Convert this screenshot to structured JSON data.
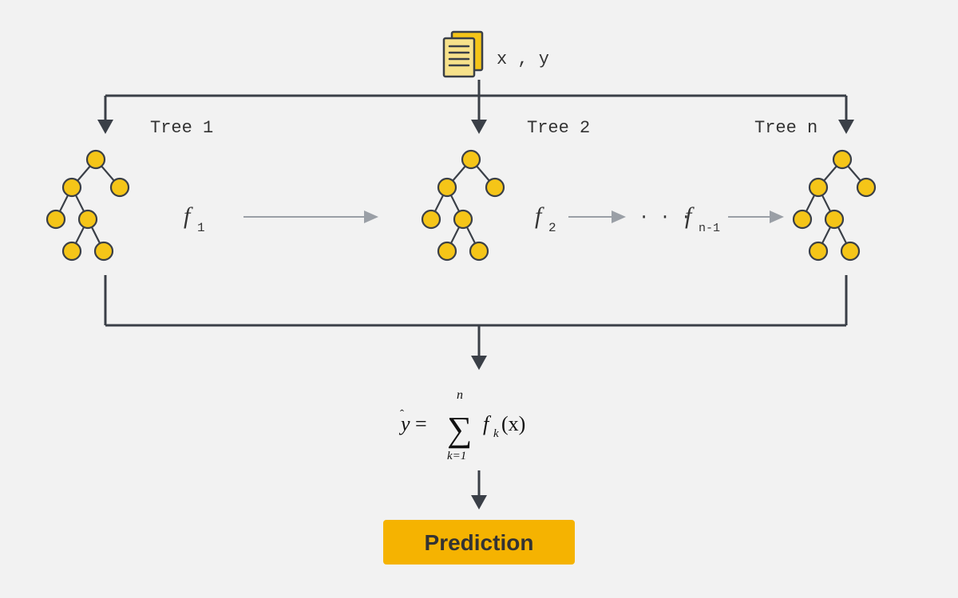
{
  "data_label": "x , y",
  "trees": [
    {
      "label": "Tree 1",
      "f_base": "f",
      "f_sub": "1"
    },
    {
      "label": "Tree 2",
      "f_base": "f",
      "f_sub": "2"
    },
    {
      "label": "Tree n",
      "f_base": "f",
      "f_sub": "n-1"
    }
  ],
  "ellipsis": "· · ·",
  "formula": {
    "lhs": "ŷ = ",
    "sum_sym": "∑",
    "upper": "n",
    "lower": "k=1",
    "rhs_f": "f",
    "rhs_k": "k",
    "rhs_paren": "(x)"
  },
  "prediction_label": "Prediction",
  "colors": {
    "accent": "#f5b301",
    "node": "#f5c518",
    "stroke": "#3a3f47",
    "light": "#9a9fa6",
    "bg": "#f2f2f2"
  }
}
